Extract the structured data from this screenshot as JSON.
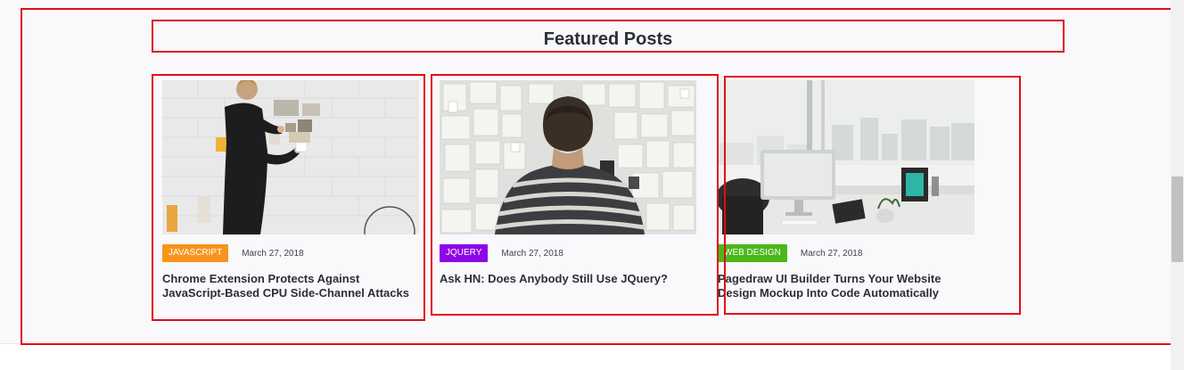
{
  "section": {
    "title": "Featured Posts"
  },
  "colors": {
    "highlight": "#e30d14",
    "javascript_badge": "#f7941d",
    "jquery_badge": "#8d06e6",
    "webdesign_badge": "#4cb71a",
    "title_text": "#2b2f3a",
    "section_bg": "#f9f9fc"
  },
  "posts": [
    {
      "category": "JAVASCRIPT",
      "date": "March 27, 2018",
      "title": "Chrome Extension Protects Against JavaScript-Based CPU Side-Channel Attacks",
      "image": "man-pinning-notes-on-white-brick-wall"
    },
    {
      "category": "JQUERY",
      "date": "March 27, 2018",
      "title": "Ask HN: Does Anybody Still Use JQuery?",
      "image": "man-looking-at-wall-of-sketches"
    },
    {
      "category": "WEB DESIGN",
      "date": "March 27, 2018",
      "title": "Pagedraw UI Builder Turns Your Website Design Mockup Into Code Automatically",
      "image": "office-desk-with-imac-and-city-view"
    }
  ]
}
